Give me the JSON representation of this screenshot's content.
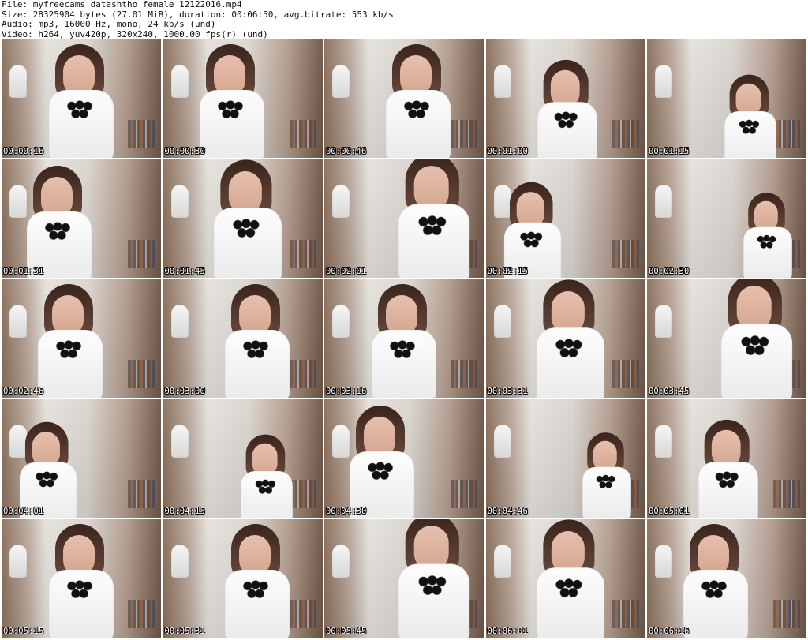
{
  "header": {
    "file": "File: myfreecams_datashtho_female_12122016.mp4",
    "size": "Size: 28325904 bytes (27.01 MiB), duration: 00:06:50, avg.bitrate: 553 kb/s",
    "audio": "Audio: mp3, 16000 Hz, mono, 24 kb/s (und)",
    "video": "Video: h264, yuv420p, 320x240, 1000.00 fps(r) (und)"
  },
  "thumbnails": [
    {
      "time": "00:00:16"
    },
    {
      "time": "00:00:30"
    },
    {
      "time": "00:00:46"
    },
    {
      "time": "00:01:00"
    },
    {
      "time": "00:01:15"
    },
    {
      "time": "00:01:31"
    },
    {
      "time": "00:01:45"
    },
    {
      "time": "00:02:01"
    },
    {
      "time": "00:02:15"
    },
    {
      "time": "00:02:30"
    },
    {
      "time": "00:02:46"
    },
    {
      "time": "00:03:00"
    },
    {
      "time": "00:03:16"
    },
    {
      "time": "00:03:31"
    },
    {
      "time": "00:03:45"
    },
    {
      "time": "00:04:01"
    },
    {
      "time": "00:04:15"
    },
    {
      "time": "00:04:30"
    },
    {
      "time": "00:04:46"
    },
    {
      "time": "00:05:01"
    },
    {
      "time": "00:05:15"
    },
    {
      "time": "00:05:31"
    },
    {
      "time": "00:05:45"
    },
    {
      "time": "00:06:01"
    },
    {
      "time": "00:06:16"
    }
  ]
}
